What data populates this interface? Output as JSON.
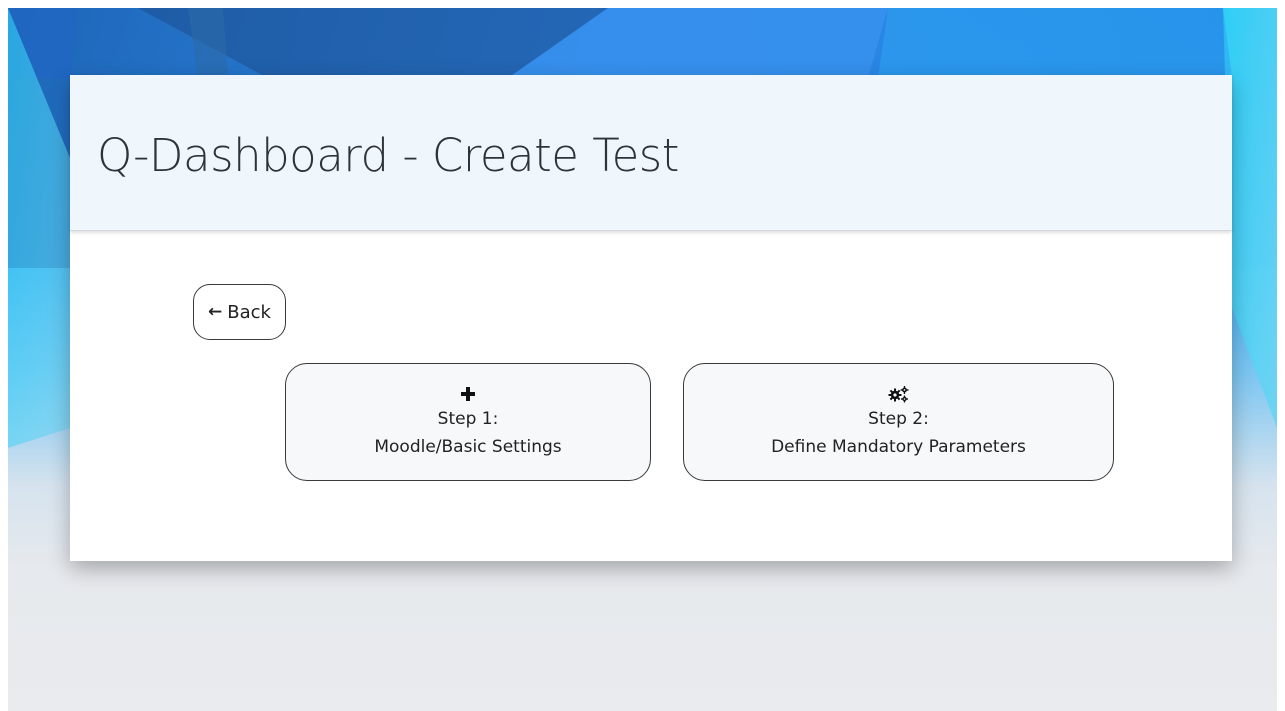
{
  "header": {
    "title": "Q-Dashboard - Create Test"
  },
  "back_button": {
    "arrow": "←",
    "label": "Back"
  },
  "steps": [
    {
      "icon": "plus-icon",
      "label": "Step 1:",
      "description": "Moodle/Basic Settings"
    },
    {
      "icon": "gears-icon",
      "label": "Step 2:",
      "description": "Define Mandatory Parameters"
    }
  ],
  "colors": {
    "background_top": "#2a8fe8",
    "background_bottom": "#e9ebee",
    "header_band": "#eef5fc",
    "card": "#ffffff",
    "button_border": "#3a3a3a",
    "title_text": "#2f3338"
  }
}
